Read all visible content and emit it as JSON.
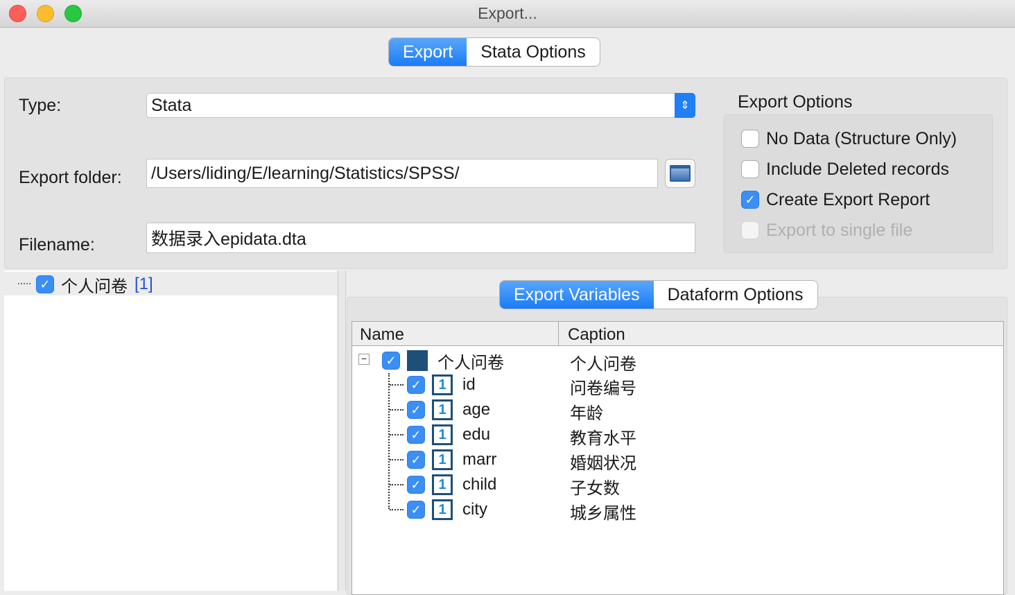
{
  "window": {
    "title": "Export..."
  },
  "tabs": [
    {
      "label": "Export",
      "active": true
    },
    {
      "label": "Stata Options",
      "active": false
    }
  ],
  "form": {
    "type_label": "Type:",
    "type_value": "Stata",
    "folder_label": "Export folder:",
    "folder_value": "/Users/liding/E/learning/Statistics/SPSS/",
    "filename_label": "Filename:",
    "filename_value": "数据录入epidata.dta"
  },
  "export_options": {
    "title": "Export Options",
    "items": [
      {
        "label": "No Data (Structure Only)",
        "checked": false,
        "disabled": false
      },
      {
        "label": "Include Deleted records",
        "checked": false,
        "disabled": false
      },
      {
        "label": "Create Export Report",
        "checked": true,
        "disabled": false
      },
      {
        "label": "Export to single file",
        "checked": false,
        "disabled": true
      }
    ]
  },
  "left_tree": {
    "label": "个人问卷",
    "count": "[1]"
  },
  "inner_tabs": [
    {
      "label": "Export Variables",
      "active": true
    },
    {
      "label": "Dataform Options",
      "active": false
    }
  ],
  "table": {
    "headers": [
      "Name",
      "Caption"
    ],
    "root": {
      "name": "个人问卷",
      "caption": "个人问卷"
    },
    "rows": [
      {
        "name": "id",
        "caption": "问卷编号"
      },
      {
        "name": "age",
        "caption": "年龄"
      },
      {
        "name": "edu",
        "caption": "教育水平"
      },
      {
        "name": "marr",
        "caption": "婚姻状况"
      },
      {
        "name": "child",
        "caption": "子女数"
      },
      {
        "name": "city",
        "caption": "城乡属性"
      }
    ]
  },
  "colors": {
    "accent": "#1a7cf5"
  }
}
